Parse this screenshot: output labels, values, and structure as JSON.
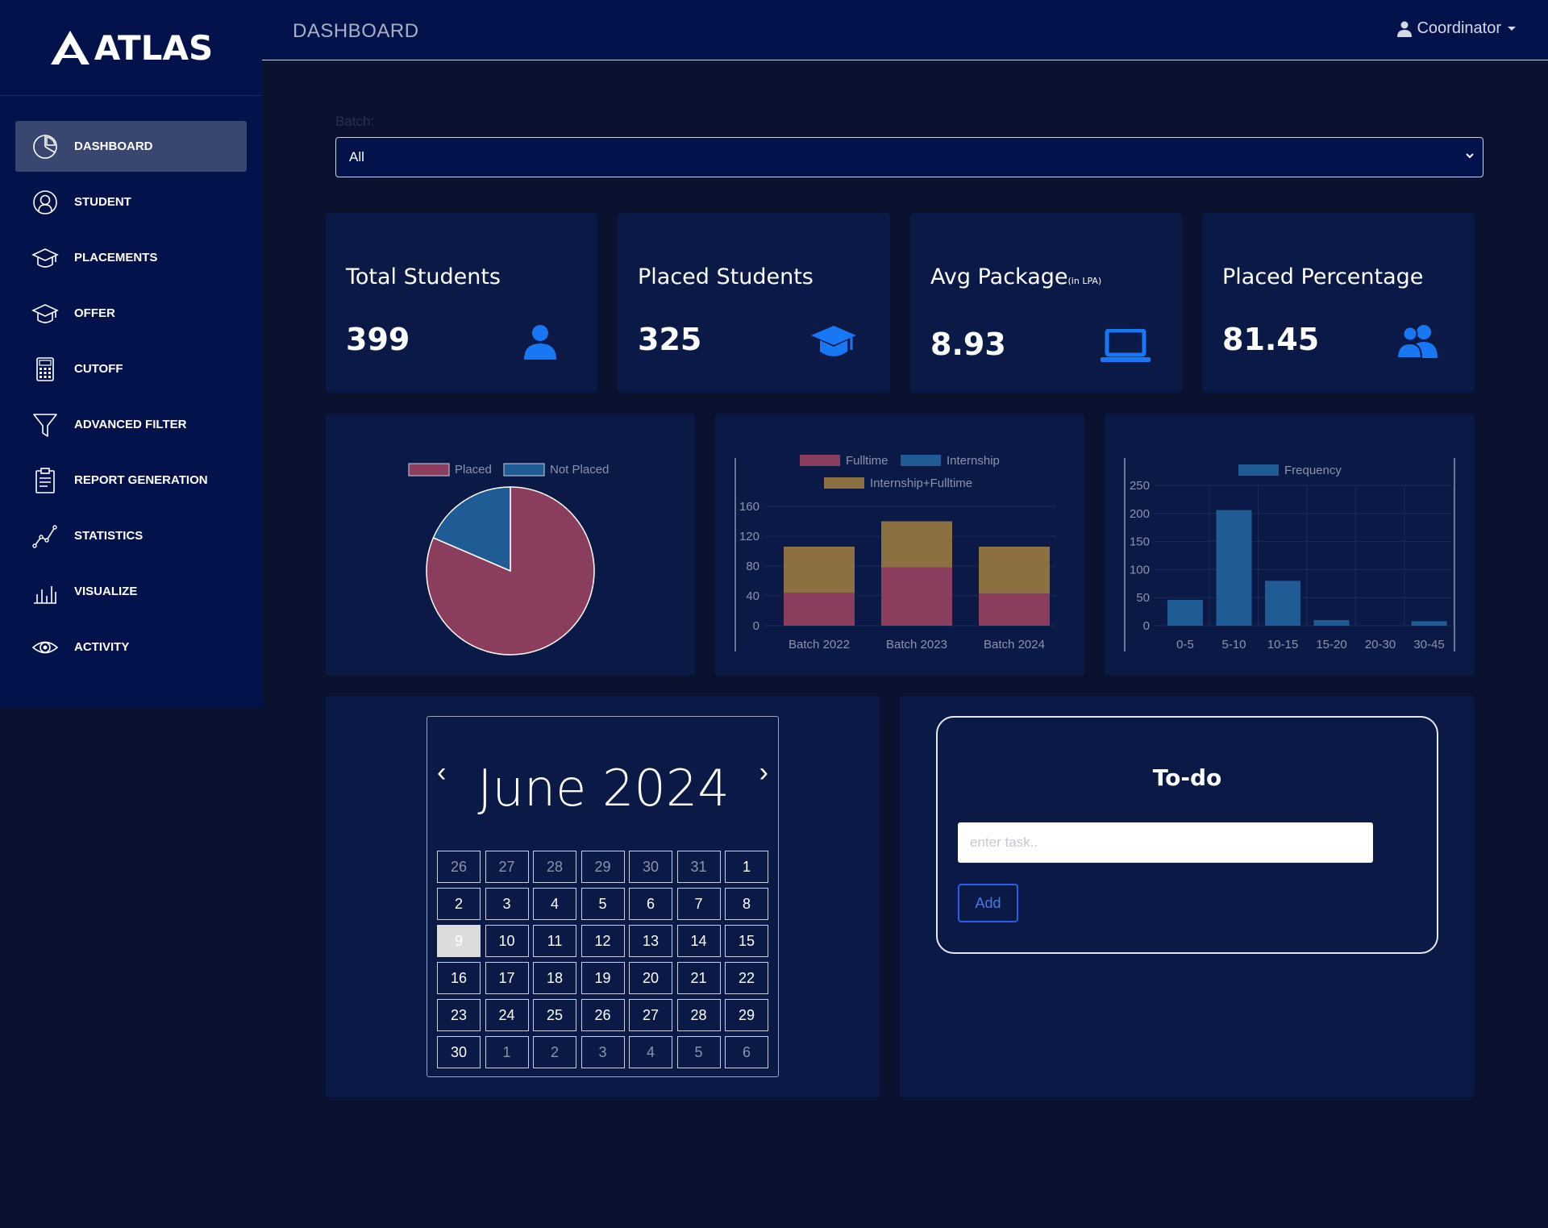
{
  "app": {
    "name": "ATLAS"
  },
  "sidebar": {
    "items": [
      {
        "label": "DASHBOARD",
        "icon": "pie-chart-icon",
        "active": true
      },
      {
        "label": "STUDENT",
        "icon": "user-circle-icon"
      },
      {
        "label": "PLACEMENTS",
        "icon": "graduation-cap-icon"
      },
      {
        "label": "OFFER",
        "icon": "graduation-cap-icon"
      },
      {
        "label": "CUTOFF",
        "icon": "calculator-icon"
      },
      {
        "label": "ADVANCED FILTER",
        "icon": "filter-icon"
      },
      {
        "label": "REPORT GENERATION",
        "icon": "clipboard-icon"
      },
      {
        "label": "STATISTICS",
        "icon": "line-graph-icon"
      },
      {
        "label": "VISUALIZE",
        "icon": "bar-graph-icon"
      },
      {
        "label": "ACTIVITY",
        "icon": "eye-icon"
      }
    ]
  },
  "header": {
    "title": "DASHBOARD",
    "user": "Coordinator"
  },
  "batch": {
    "label": "Batch:",
    "selected": "All"
  },
  "stats": [
    {
      "title": "Total Students",
      "value": "399",
      "icon": "user-icon"
    },
    {
      "title": "Placed Students",
      "value": "325",
      "icon": "graduation-cap-icon"
    },
    {
      "title": "Avg Package",
      "subtitle": "(in LPA)",
      "value": "8.93",
      "icon": "laptop-icon"
    },
    {
      "title": "Placed Percentage",
      "value": "81.45",
      "icon": "users-icon"
    }
  ],
  "colors": {
    "placed": "#8b3d5e",
    "not_placed": "#1f5c96",
    "internship_fulltime": "#8c7041",
    "accent_blue": "#1877f2"
  },
  "chart_data": [
    {
      "type": "pie",
      "legend": [
        "Placed",
        "Not Placed"
      ],
      "values": [
        325,
        74
      ]
    },
    {
      "type": "bar",
      "stacked": true,
      "categories": [
        "Batch 2022",
        "Batch 2023",
        "Batch 2024"
      ],
      "series": [
        {
          "name": "Fulltime",
          "values": [
            44,
            78,
            43
          ]
        },
        {
          "name": "Internship",
          "values": [
            0,
            0,
            0
          ]
        },
        {
          "name": "Internship+Fulltime",
          "values": [
            62,
            62,
            63
          ]
        }
      ],
      "yticks": [
        "0",
        "40",
        "80",
        "120",
        "160"
      ],
      "ylim": [
        0,
        160
      ]
    },
    {
      "type": "bar",
      "categories": [
        "0-5",
        "5-10",
        "10-15",
        "15-20",
        "20-30",
        "30-45"
      ],
      "series": [
        {
          "name": "Frequency",
          "values": [
            46,
            206,
            80,
            10,
            0,
            8
          ]
        }
      ],
      "yticks": [
        "0",
        "50",
        "100",
        "150",
        "200",
        "250"
      ],
      "ylim": [
        0,
        250
      ]
    }
  ],
  "calendar": {
    "month_label": "June 2024",
    "prev": "‹",
    "next": "›",
    "today": "9",
    "weeks": [
      [
        {
          "d": "26",
          "m": true
        },
        {
          "d": "27",
          "m": true
        },
        {
          "d": "28",
          "m": true
        },
        {
          "d": "29",
          "m": true
        },
        {
          "d": "30",
          "m": true
        },
        {
          "d": "31",
          "m": true
        },
        {
          "d": "1"
        }
      ],
      [
        {
          "d": "2"
        },
        {
          "d": "3"
        },
        {
          "d": "4"
        },
        {
          "d": "5"
        },
        {
          "d": "6"
        },
        {
          "d": "7"
        },
        {
          "d": "8"
        }
      ],
      [
        {
          "d": "9",
          "t": true
        },
        {
          "d": "10"
        },
        {
          "d": "11"
        },
        {
          "d": "12"
        },
        {
          "d": "13"
        },
        {
          "d": "14"
        },
        {
          "d": "15"
        }
      ],
      [
        {
          "d": "16"
        },
        {
          "d": "17"
        },
        {
          "d": "18"
        },
        {
          "d": "19"
        },
        {
          "d": "20"
        },
        {
          "d": "21"
        },
        {
          "d": "22"
        }
      ],
      [
        {
          "d": "23"
        },
        {
          "d": "24"
        },
        {
          "d": "25"
        },
        {
          "d": "26"
        },
        {
          "d": "27"
        },
        {
          "d": "28"
        },
        {
          "d": "29"
        }
      ],
      [
        {
          "d": "30"
        },
        {
          "d": "1",
          "m": true
        },
        {
          "d": "2",
          "m": true
        },
        {
          "d": "3",
          "m": true
        },
        {
          "d": "4",
          "m": true
        },
        {
          "d": "5",
          "m": true
        },
        {
          "d": "6",
          "m": true
        }
      ]
    ]
  },
  "todo": {
    "title": "To-do",
    "placeholder": "enter task..",
    "add_label": "Add"
  }
}
